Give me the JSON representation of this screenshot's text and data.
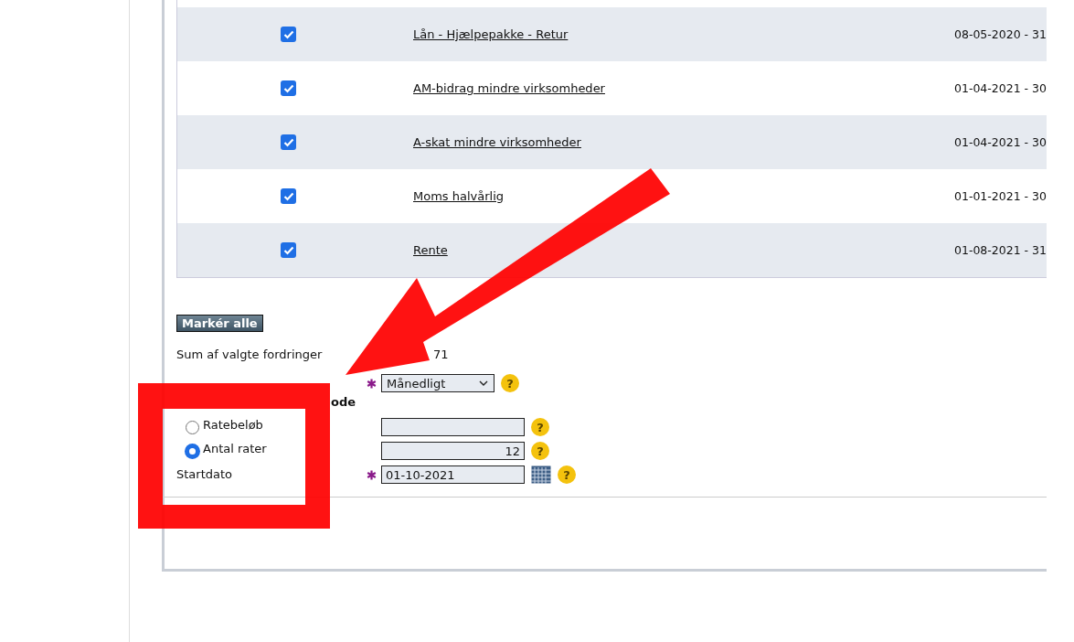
{
  "claims": [
    {
      "checked": true,
      "name": "Lån - Hjælpepakke - Retur",
      "period": "08-05-2020 - 31"
    },
    {
      "checked": true,
      "name": "AM-bidrag mindre virksomheder",
      "period": "01-04-2021 - 30"
    },
    {
      "checked": true,
      "name": "A-skat mindre virksomheder",
      "period": "01-04-2021 - 30"
    },
    {
      "checked": true,
      "name": "Moms halvårlig",
      "period": "01-01-2021 - 30"
    },
    {
      "checked": true,
      "name": "Rente",
      "period": "01-08-2021 - 31"
    }
  ],
  "mark_all_button": "Markér alle",
  "sum": {
    "label": "Sum af valgte fordringer",
    "value": "71"
  },
  "frequency": {
    "required": true,
    "value": "Månedligt",
    "help": "?"
  },
  "method": {
    "label": "ode",
    "options": [
      {
        "label": "Ratebeløb",
        "selected": false,
        "help": "?"
      },
      {
        "label": "Antal rater",
        "selected": true,
        "value": "12",
        "help": "?"
      }
    ]
  },
  "start_date": {
    "label": "Startdato",
    "required": true,
    "value": "01-10-2021",
    "help": "?"
  }
}
